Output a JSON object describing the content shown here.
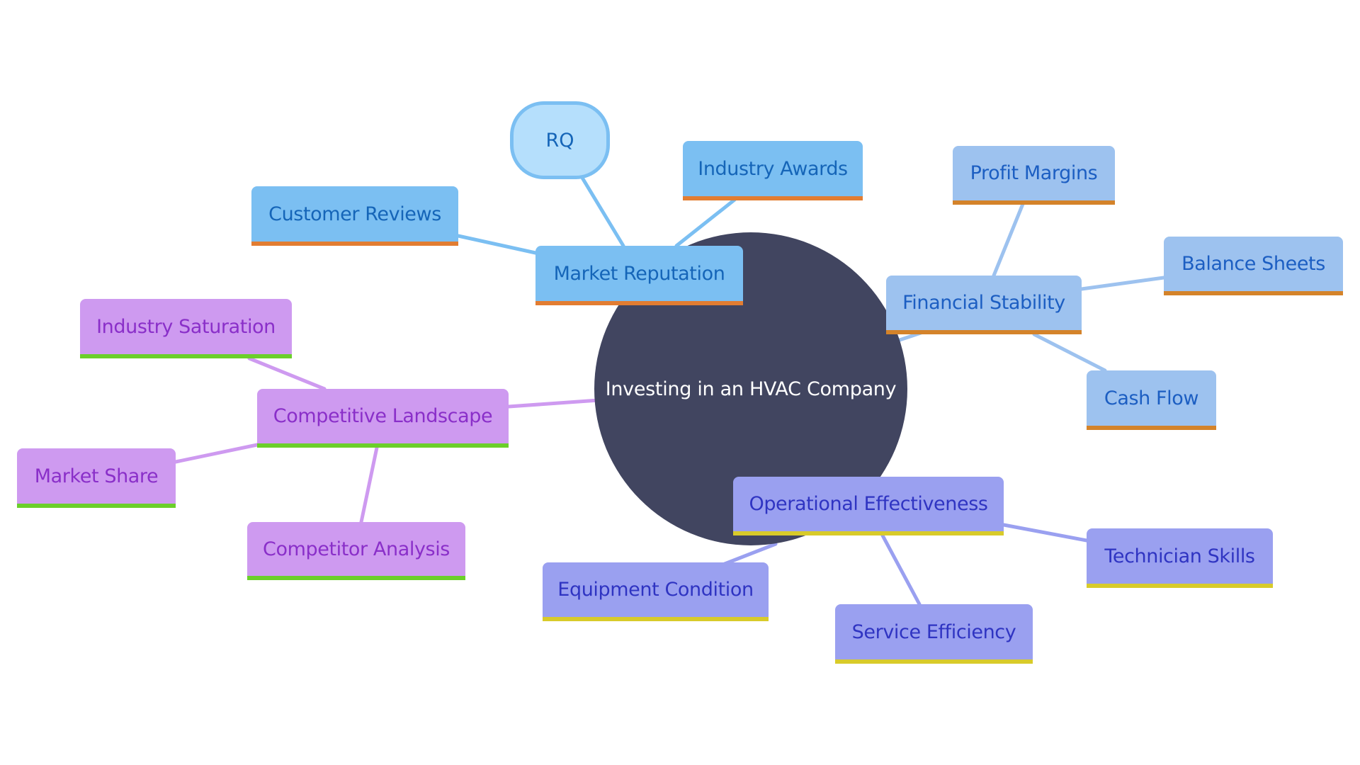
{
  "diagram": {
    "type": "mindmap",
    "root": {
      "label": "Investing in an HVAC Company",
      "color": "#414560"
    },
    "branches": [
      {
        "id": "rep",
        "label": "Market Reputation",
        "fill": "#7BBFF2",
        "text": "#1565B8",
        "accent": "#E27D32",
        "line": "#7BBFF2",
        "children": [
          {
            "id": "rep-c1",
            "label": "Customer Reviews"
          },
          {
            "id": "rep-c2",
            "label": "RQ",
            "shape": "rounded"
          },
          {
            "id": "rep-c3",
            "label": "Industry Awards"
          }
        ]
      },
      {
        "id": "fin",
        "label": "Financial Stability",
        "fill": "#9DC2EF",
        "text": "#1C5EC2",
        "accent": "#D4832A",
        "line": "#9DC2EF",
        "children": [
          {
            "id": "fin-c1",
            "label": "Profit Margins"
          },
          {
            "id": "fin-c2",
            "label": "Balance Sheets"
          },
          {
            "id": "fin-c3",
            "label": "Cash Flow"
          }
        ]
      },
      {
        "id": "op",
        "label": "Operational Effectiveness",
        "fill": "#9AA0F0",
        "text": "#2F34C2",
        "accent": "#D8CB2A",
        "line": "#9AA0F0",
        "children": [
          {
            "id": "op-c1",
            "label": "Equipment Condition"
          },
          {
            "id": "op-c2",
            "label": "Service Efficiency"
          },
          {
            "id": "op-c3",
            "label": "Technician Skills"
          }
        ]
      },
      {
        "id": "comp",
        "label": "Competitive Landscape",
        "fill": "#CE9AF0",
        "text": "#8A2FC9",
        "accent": "#6BCF2A",
        "line": "#CE9AF0",
        "children": [
          {
            "id": "comp-c1",
            "label": "Industry Saturation"
          },
          {
            "id": "comp-c2",
            "label": "Market Share"
          },
          {
            "id": "comp-c3",
            "label": "Competitor Analysis"
          }
        ]
      }
    ]
  }
}
